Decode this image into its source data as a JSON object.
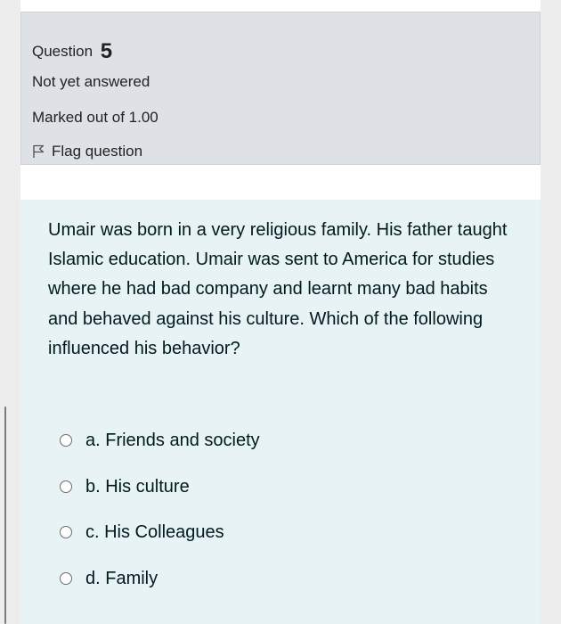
{
  "question_info": {
    "heading_label": "Question",
    "number": "5",
    "status": "Not yet answered",
    "marks": "Marked out of 1.00",
    "flag_label": "Flag question"
  },
  "question": {
    "text": "Umair was born in a very religious  family. His father taught Islamic education.  Umair was sent to America for studies where he had bad company and learnt many bad habits and behaved against his culture. Which of the following influenced his behavior?",
    "options": [
      {
        "label": "a. Friends and society"
      },
      {
        "label": "b. His culture"
      },
      {
        "label": "c. His Colleagues"
      },
      {
        "label": "d. Family"
      }
    ]
  },
  "colors": {
    "info_background": "#dee2e6",
    "question_background": "#e7f3f5",
    "text": "#001a1e"
  },
  "icons": {
    "flag": "flag-outline-icon",
    "radio": "radio-unchecked-icon"
  }
}
